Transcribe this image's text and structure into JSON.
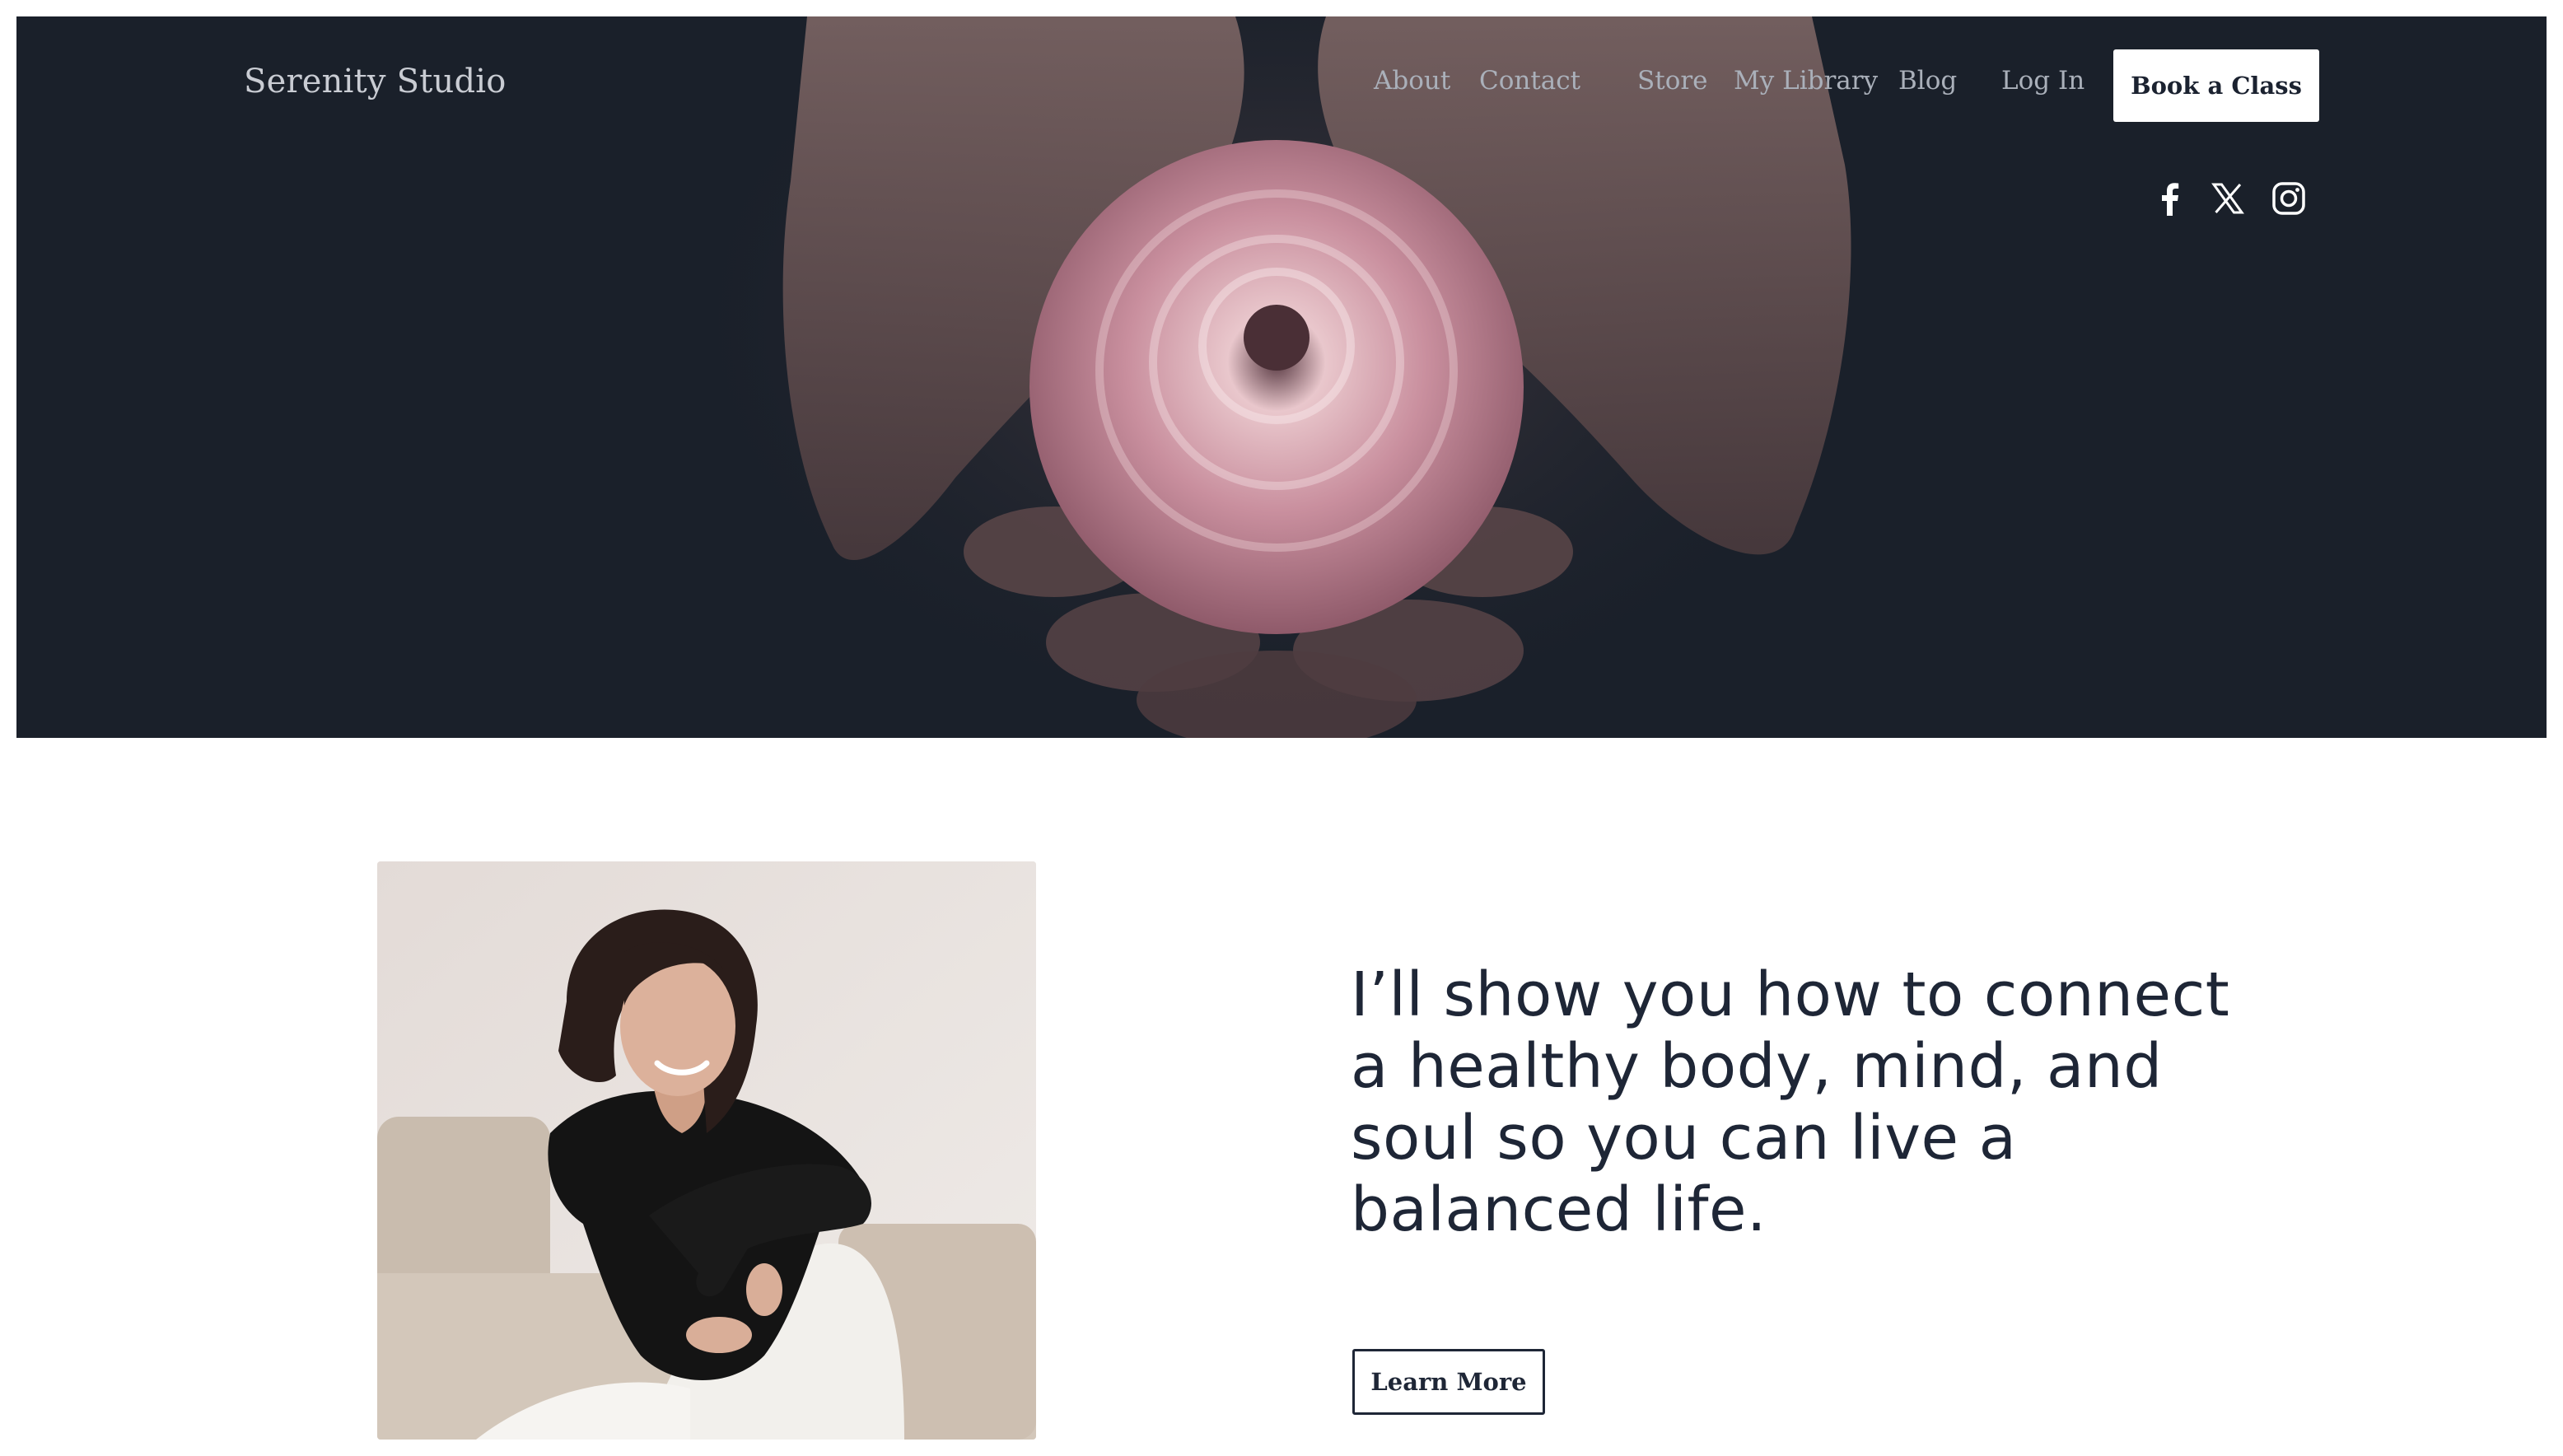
{
  "header": {
    "brand": "Serenity Studio",
    "nav": [
      "About",
      "Contact",
      "Store",
      "My Library",
      "Blog",
      "Log In"
    ],
    "cta": "Book a Class",
    "social": [
      "facebook-icon",
      "x-icon",
      "instagram-icon"
    ]
  },
  "hero": {
    "image": "hands-holding-ranunculus-flower"
  },
  "intro": {
    "image": "smiling-woman-seated-on-sofa",
    "headline": "I’ll show you how to connect a healthy body, mind, and soul so you can live a balanced life.",
    "button": "Learn More"
  },
  "colors": {
    "hero_bg": "#1a202a",
    "text_dark": "#1e2636",
    "nav_text": "#aab0ba",
    "button_bg": "#ffffff"
  }
}
